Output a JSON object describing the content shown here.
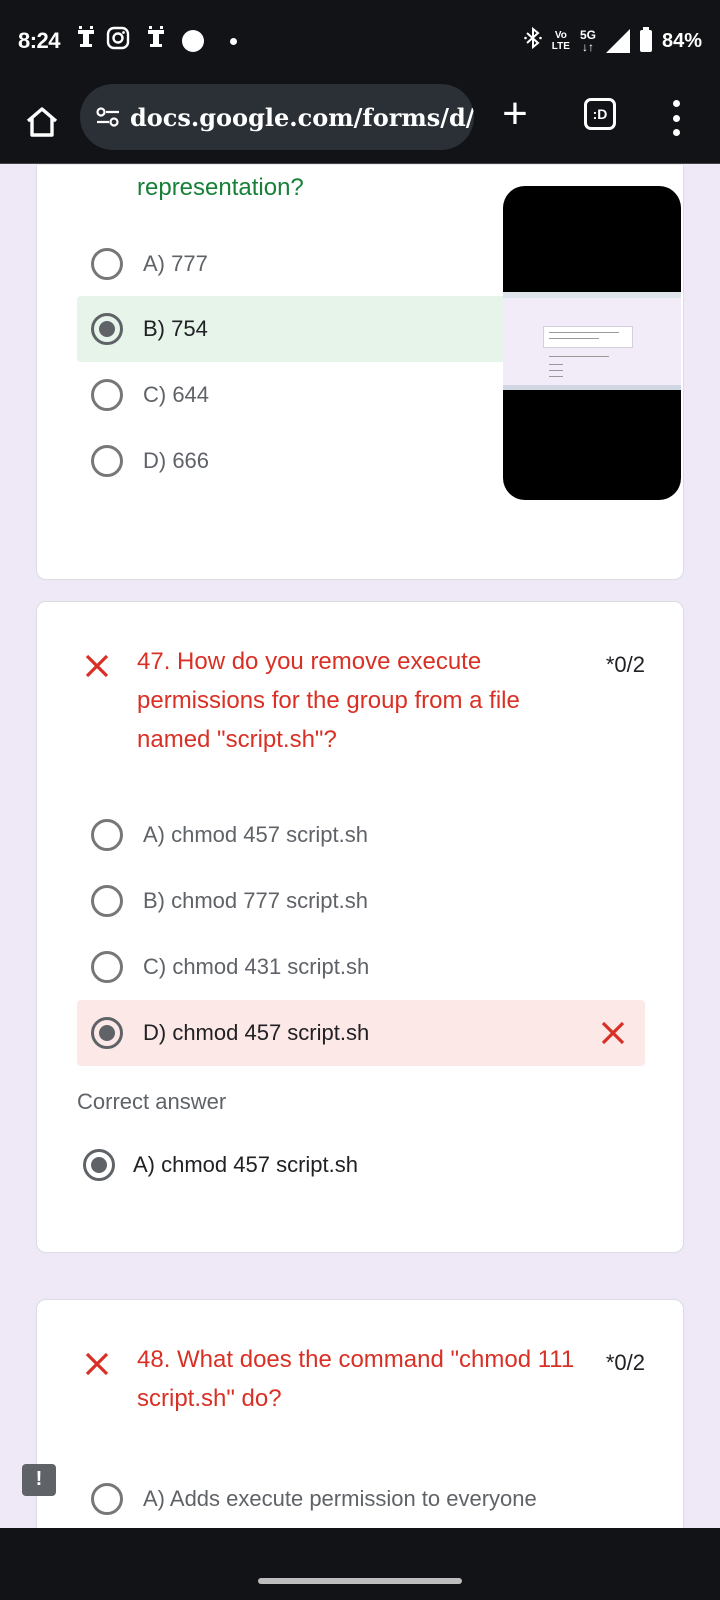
{
  "status_bar": {
    "time": "8:24",
    "volte": "Vo",
    "lte": "LTE",
    "network": "5G",
    "battery": "84%"
  },
  "browser": {
    "url": "docs.google.com/forms/d/",
    "tab_label": ":D"
  },
  "q46": {
    "title_tail": "representation?",
    "options": [
      "A) 777",
      "B) 754",
      "C) 644",
      "D) 666"
    ],
    "selected_index": 1
  },
  "q47": {
    "title": "47. How do you remove execute permissions for the group from a file named \"script.sh\"?",
    "score": "*0/2",
    "options": [
      "A) chmod 457 script.sh",
      "B) chmod 777 script.sh",
      "C) chmod 431 script.sh",
      "D) chmod 457 script.sh"
    ],
    "selected_index": 3,
    "correct_label": "Correct answer",
    "correct_answer": "A) chmod 457 script.sh"
  },
  "q48": {
    "title": "48. What does the command \"chmod 111 script.sh\" do?",
    "score": "*0/2",
    "options": [
      "A) Adds execute permission to everyone"
    ]
  },
  "feedback_icon": "!",
  "colors": {
    "incorrect": "#d93025",
    "correct": "#188038",
    "selected_correct_bg": "#e6f4ea",
    "selected_incorrect_bg": "#fce8e6"
  }
}
